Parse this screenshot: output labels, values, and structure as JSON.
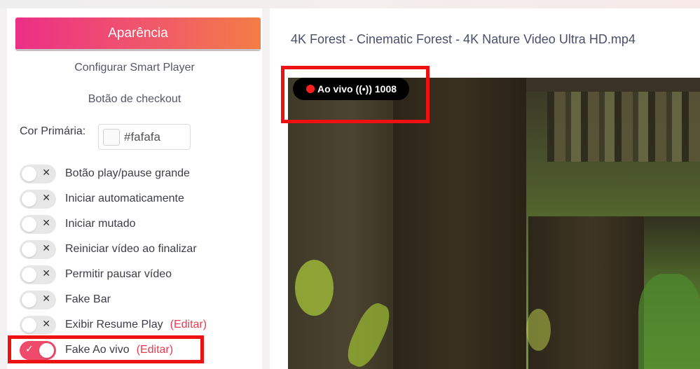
{
  "sidebar": {
    "tabs": {
      "appearance": "Aparência",
      "configure": "Configurar Smart Player",
      "checkout": "Botão de checkout"
    },
    "primary_color": {
      "label": "Cor Primária:",
      "value": "#fafafa"
    },
    "toggles": [
      {
        "label": "Botão play/pause grande",
        "enabled": false
      },
      {
        "label": "Iniciar automaticamente",
        "enabled": false
      },
      {
        "label": "Iniciar mutado",
        "enabled": false
      },
      {
        "label": "Reiniciar vídeo ao finalizar",
        "enabled": false
      },
      {
        "label": "Permitir pausar vídeo",
        "enabled": false
      },
      {
        "label": "Fake Bar",
        "enabled": false
      },
      {
        "label": "Exibir Resume Play",
        "enabled": false,
        "edit": "(Editar)"
      },
      {
        "label": "Fake Ao vivo",
        "enabled": true,
        "edit": "(Editar)"
      }
    ]
  },
  "main": {
    "video_title": "4K Forest - Cinematic Forest - 4K Nature Video Ultra HD.mp4",
    "live_badge": {
      "text": "Ao vivo ((•)) 1008"
    }
  },
  "icons": {
    "toggle_off_mark": "✕",
    "toggle_on_mark": "✓"
  },
  "colors": {
    "accent": "#ef4a6a",
    "highlight": "#ee1111",
    "live_dot": "#ff1f1f"
  }
}
